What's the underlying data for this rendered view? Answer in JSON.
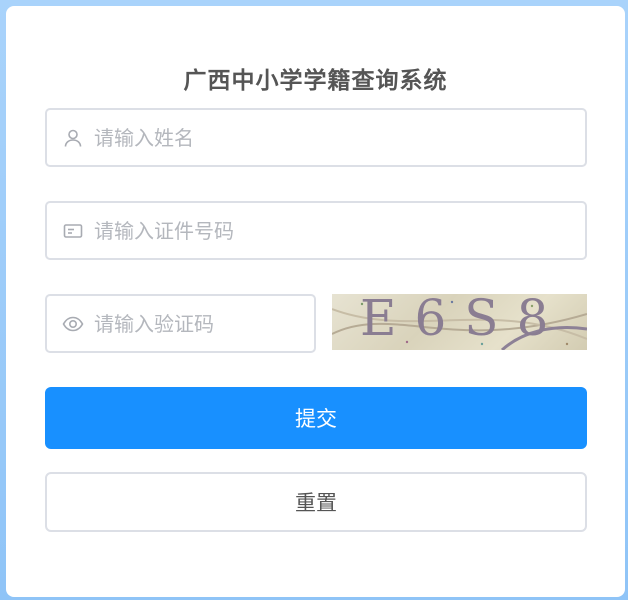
{
  "title": "广西中小学学籍查询系统",
  "form": {
    "name": {
      "placeholder": "请输入姓名",
      "value": "",
      "icon": "user-icon"
    },
    "id_number": {
      "placeholder": "请输入证件号码",
      "value": "",
      "icon": "id-card-icon"
    },
    "captcha": {
      "placeholder": "请输入验证码",
      "value": "",
      "icon": "eye-icon",
      "image_text": "E6S8"
    }
  },
  "buttons": {
    "submit": "提交",
    "reset": "重置"
  },
  "colors": {
    "primary": "#1890ff",
    "background": "#a9d3fb",
    "border": "#dcdfe6",
    "placeholder": "#b4b7bd"
  }
}
